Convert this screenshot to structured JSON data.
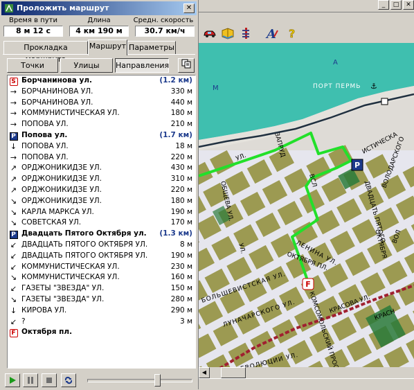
{
  "window": {
    "title": "Проложить маршрут",
    "close_label": "✕"
  },
  "stats": {
    "time_label": "Время в пути",
    "time_value": "8 м 12 с",
    "length_label": "Длина",
    "length_value": "4 км 190 м",
    "speed_label": "Средн. скорость",
    "speed_value": "30.7 км/ч"
  },
  "tabs": [
    "Прокладка маршрута",
    "Маршрут",
    "Параметры"
  ],
  "subtabs": [
    "Точки",
    "Улицы",
    "Направления"
  ],
  "route": [
    {
      "icon": "S",
      "name": "Борчанинова ул.",
      "dist": "(1.2 км)",
      "waypoint": true
    },
    {
      "icon": "→",
      "name": "БОРЧАНИНОВА УЛ.",
      "dist": "330 м"
    },
    {
      "icon": "→",
      "name": "БОРЧАНИНОВА УЛ.",
      "dist": "440 м"
    },
    {
      "icon": "→",
      "name": "КОММУНИСТИЧЕСКАЯ УЛ.",
      "dist": "180 м"
    },
    {
      "icon": "→",
      "name": "ПОПОВА УЛ.",
      "dist": "210 м"
    },
    {
      "icon": "P",
      "name": "Попова ул.",
      "dist": "(1.7 км)",
      "waypoint": true
    },
    {
      "icon": "↓",
      "name": "ПОПОВА УЛ.",
      "dist": "18 м"
    },
    {
      "icon": "→",
      "name": "ПОПОВА УЛ.",
      "dist": "220 м"
    },
    {
      "icon": "↗",
      "name": "ОРДЖОНИКИДЗЕ УЛ.",
      "dist": "430 м"
    },
    {
      "icon": "↗",
      "name": "ОРДЖОНИКИДЗЕ УЛ.",
      "dist": "310 м"
    },
    {
      "icon": "↗",
      "name": "ОРДЖОНИКИДЗЕ УЛ.",
      "dist": "220 м"
    },
    {
      "icon": "↘",
      "name": "ОРДЖОНИКИДЗЕ УЛ.",
      "dist": "180 м"
    },
    {
      "icon": "↘",
      "name": "КАРЛА МАРКСА УЛ.",
      "dist": "190 м"
    },
    {
      "icon": "↘",
      "name": "СОВЕТСКАЯ УЛ.",
      "dist": "170 м"
    },
    {
      "icon": "P",
      "name": "Двадцать Пятого Октября ул.",
      "dist": "(1.3 км)",
      "waypoint": true
    },
    {
      "icon": "↙",
      "name": "ДВАДЦАТЬ ПЯТОГО ОКТЯБРЯ УЛ.",
      "dist": "8 м"
    },
    {
      "icon": "↙",
      "name": "ДВАДЦАТЬ ПЯТОГО ОКТЯБРЯ УЛ.",
      "dist": "190 м"
    },
    {
      "icon": "↙",
      "name": "КОММУНИСТИЧЕСКАЯ УЛ.",
      "dist": "230 м"
    },
    {
      "icon": "↘",
      "name": "КОММУНИСТИЧЕСКАЯ УЛ.",
      "dist": "160 м"
    },
    {
      "icon": "↙",
      "name": "ГАЗЕТЫ \"ЗВЕЗДА\" УЛ.",
      "dist": "150 м"
    },
    {
      "icon": "↘",
      "name": "ГАЗЕТЫ \"ЗВЕЗДА\" УЛ.",
      "dist": "280 м"
    },
    {
      "icon": "↓",
      "name": "КИРОВА УЛ.",
      "dist": "290 м"
    },
    {
      "icon": "↙",
      "name": "?",
      "dist": "3 м"
    },
    {
      "icon": "F",
      "name": "Октября пл.",
      "dist": "",
      "waypoint": true
    }
  ],
  "map_labels": {
    "port": "ПОРТ ПЕРМЬ",
    "lenina": "ЛЕНИНА УЛ.",
    "oktyabrya_pl": "ОКТЯБРЯ ПЛ.",
    "bolshevistskaya": "БОЛЬШЕВИСТСКАЯ УЛ.",
    "lunacharskogo": "ЛУНАЧАРСКОГО УЛ.",
    "revolyutsii": "РЕВОЛЮЦИИ УЛ.",
    "krasova": "КРАСОВА УЛ.",
    "dvadtsat_pyatogo": "ДВАДЦАТЬ ПЯТОГО",
    "oktyabrya": "ОКТЯБРЯ",
    "kommunisticheskaya": "КОММУНИСТИЧЕСКАЯ",
    "komsomolskiy": "КОМСОМОЛЬСКИЙ ПРОСП.",
    "obshcheva": "ОБЩЕВА УЛ.",
    "volodarskogo": "ВОЛОДАРСКОГО",
    "letter_m": "М",
    "letter_a": "А",
    "ul_prefix": "УЛ.",
    "ul_suffix": "УЛ.",
    "vsl": "ВСЛ",
    "fragment": "ИСТИЧЕСКА",
    "zaprudnaya": "ЗАПРУД",
    "krasnova": "КРАСН",
    "vol": "ВОЛ"
  },
  "colors": {
    "water": "#3fbfaf",
    "block": "#9c9a52",
    "road": "#e8e8f0",
    "route": "#22e02a",
    "rail": "#a02030",
    "green": "#2a7a3a"
  },
  "player": {
    "slider_fraction": 0.68
  }
}
